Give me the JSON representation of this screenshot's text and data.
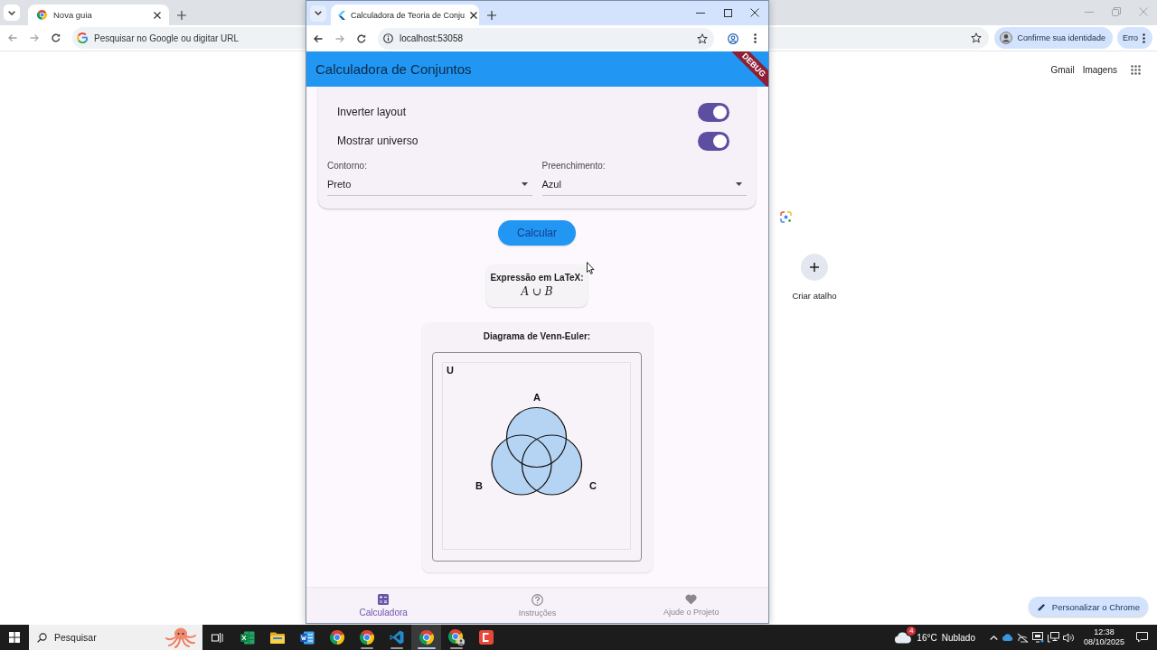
{
  "background_window": {
    "tabs": [
      {
        "title": "Nova guia"
      }
    ],
    "address_bar": {
      "placeholder": "Pesquisar no Google ou digitar URL"
    },
    "identity_chip": "Confirme sua identidade",
    "error_chip": "Erro",
    "header_links": [
      "Gmail",
      "Imagens"
    ],
    "shortcuts": [
      {
        "label": "Criar atalho"
      }
    ],
    "customize_button": "Personalizar o Chrome"
  },
  "app_window": {
    "tabs": [
      {
        "title": "Calculadora de Teoria de Conju"
      }
    ],
    "address_bar": {
      "value": "localhost:53058"
    },
    "app_bar": {
      "title": "Calculadora de Conjuntos",
      "banner": "DEBUG"
    },
    "toggles": [
      {
        "label": "Inverter layout",
        "on": true
      },
      {
        "label": "Mostrar universo",
        "on": true
      }
    ],
    "dropdowns": [
      {
        "label": "Contorno:",
        "value": "Preto"
      },
      {
        "label": "Preenchimento:",
        "value": "Azul"
      }
    ],
    "calculate_button": "Calcular",
    "latex": {
      "title": "Expressão em LaTeX:",
      "expression": "*A* ∪ *B*"
    },
    "venn": {
      "title": "Diagrama de Venn-Euler:",
      "universe_label": "U",
      "sets": [
        {
          "label": "A"
        },
        {
          "label": "B"
        },
        {
          "label": "C"
        }
      ]
    },
    "bottom_nav": [
      {
        "label": "Calculadora",
        "selected": true
      },
      {
        "label": "Instruções",
        "selected": false
      },
      {
        "label": "Ajude o Projeto",
        "selected": false
      }
    ]
  },
  "taskbar": {
    "search": {
      "placeholder": "Pesquisar"
    },
    "apps": [
      {
        "kind": "sheet",
        "running": false,
        "selected": false
      },
      {
        "kind": "folder",
        "running": false,
        "selected": false
      },
      {
        "kind": "doc",
        "running": false,
        "selected": false
      },
      {
        "kind": "browser",
        "running": false,
        "selected": false
      },
      {
        "kind": "browser",
        "running": true,
        "selected": false
      },
      {
        "kind": "editor",
        "running": true,
        "selected": false
      },
      {
        "kind": "browser",
        "running": true,
        "selected": true
      },
      {
        "kind": "webapp",
        "running": true,
        "selected": false
      },
      {
        "kind": "tile",
        "running": false,
        "selected": false
      }
    ],
    "weather": {
      "badge": "4",
      "temperature": "16°C",
      "condition": "Nublado"
    },
    "clock": {
      "time": "12:38",
      "date": "08/10/2025"
    }
  }
}
